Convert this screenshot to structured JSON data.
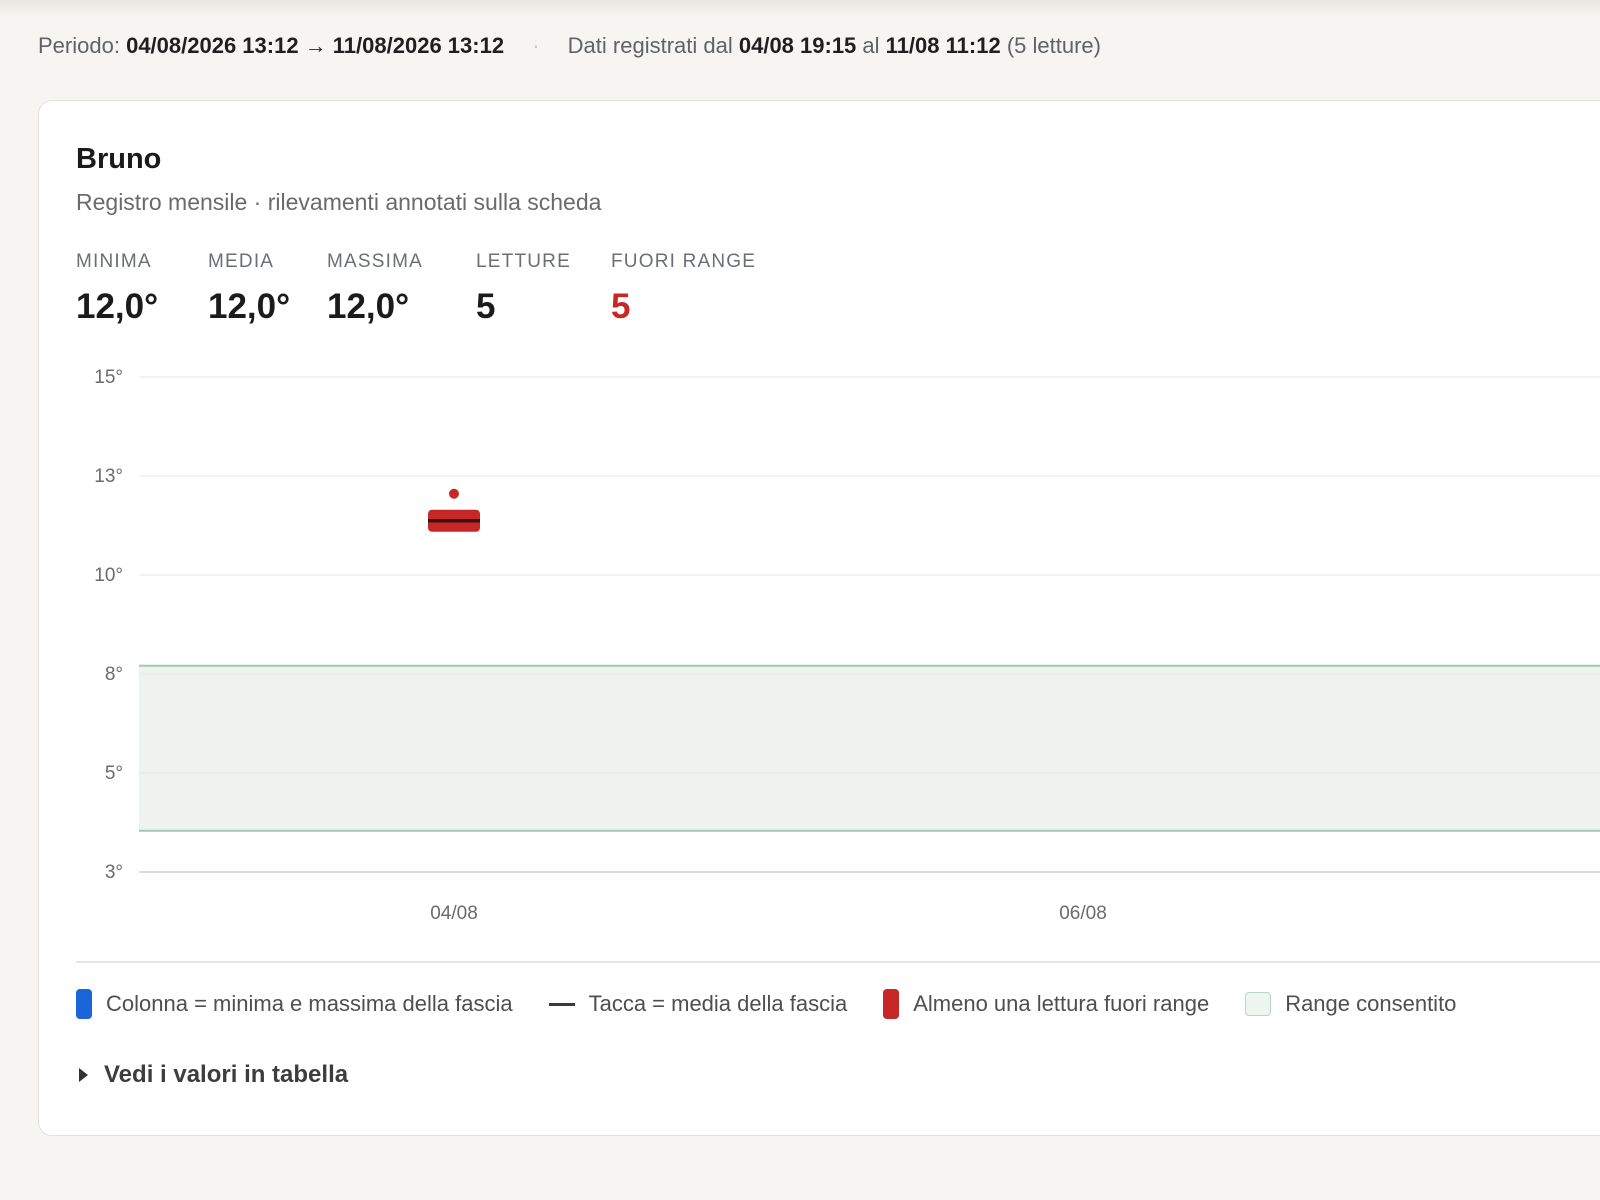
{
  "period": {
    "label": "Periodo:",
    "range": "04/08/2026 13:12 → 11/08/2026 13:12",
    "recorded_prefix": "Dati registrati dal",
    "recorded_from": "04/08 19:15",
    "recorded_mid": "al",
    "recorded_to": "11/08 11:12",
    "recorded_count": "(5 letture)"
  },
  "card": {
    "title": "Bruno",
    "subtitle": "Registro mensile · rilevamenti annotati sulla scheda"
  },
  "stats": [
    {
      "label": "Minima",
      "value": "12,0°"
    },
    {
      "label": "Media",
      "value": "12,0°"
    },
    {
      "label": "Massima",
      "value": "12,0°"
    },
    {
      "label": "Letture",
      "value": "5"
    },
    {
      "label": "Fuori range",
      "value": "5"
    }
  ],
  "chart_data": {
    "type": "bar",
    "y_ticks": [
      "15°",
      "13°",
      "10°",
      "8°",
      "5°",
      "3°"
    ],
    "x_ticks": [
      "04/08",
      "06/08"
    ],
    "ylim": [
      3,
      15
    ],
    "allowed_range": [
      4,
      8
    ],
    "series": [
      {
        "category": "04/08",
        "min": 12.0,
        "max": 12.0,
        "mean": 12.0,
        "out_of_range": true,
        "outlier_point": 12.0
      }
    ]
  },
  "legend": [
    {
      "label": "Colonna = minima e massima della fascia",
      "icon": "blue-column",
      "color": "#1a66d9"
    },
    {
      "label": "Tacca = media della fascia",
      "icon": "dash-tick",
      "color": "#3a3a3a"
    },
    {
      "label": "Almeno una lettura fuori range",
      "icon": "red-column",
      "color": "#c62828"
    },
    {
      "label": "Range consentito",
      "icon": "green-box",
      "color": "#eef5f1"
    }
  ],
  "details_label": "Vedi i valori in tabella",
  "colors": {
    "accent_blue": "#1a66d9",
    "alert_red": "#c62828",
    "range_fill": "#eef3f0",
    "range_border": "#9ccab3"
  }
}
